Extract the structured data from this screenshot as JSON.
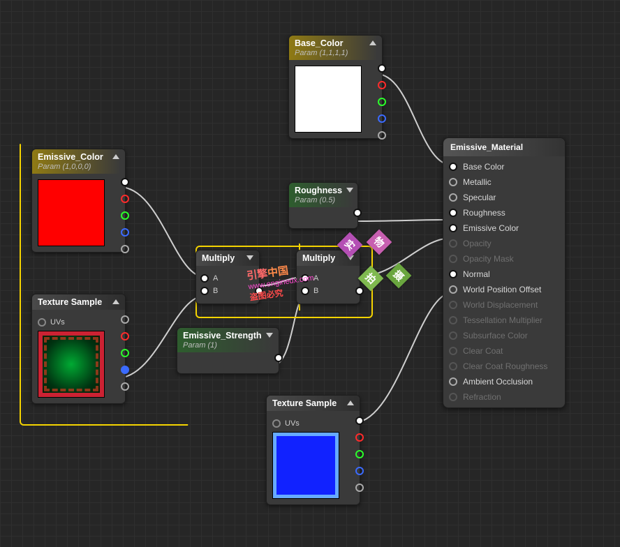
{
  "nodes": {
    "base_color": {
      "title": "Base_Color",
      "sub": "Param (1,1,1,1)"
    },
    "emissive_color": {
      "title": "Emissive_Color",
      "sub": "Param (1,0,0,0)"
    },
    "roughness": {
      "title": "Roughness",
      "sub": "Param (0.5)"
    },
    "emissive_str": {
      "title": "Emissive_Strength",
      "sub": "Param (1)"
    },
    "multiply1": {
      "title": "Multiply"
    },
    "multiply2": {
      "title": "Multiply"
    },
    "texsample1": {
      "title": "Texture Sample"
    },
    "texsample2": {
      "title": "Texture Sample"
    }
  },
  "labels": {
    "pin_a": "A",
    "pin_b": "B",
    "uvs": "UVs"
  },
  "result": {
    "title": "Emissive_Material",
    "pins": [
      {
        "label": "Base Color",
        "active": true,
        "connected": true
      },
      {
        "label": "Metallic",
        "active": true,
        "connected": false
      },
      {
        "label": "Specular",
        "active": true,
        "connected": false
      },
      {
        "label": "Roughness",
        "active": true,
        "connected": true
      },
      {
        "label": "Emissive Color",
        "active": true,
        "connected": true
      },
      {
        "label": "Opacity",
        "active": false,
        "connected": false
      },
      {
        "label": "Opacity Mask",
        "active": false,
        "connected": false
      },
      {
        "label": "Normal",
        "active": true,
        "connected": true
      },
      {
        "label": "World Position Offset",
        "active": true,
        "connected": false
      },
      {
        "label": "World Displacement",
        "active": false,
        "connected": false
      },
      {
        "label": "Tessellation Multiplier",
        "active": false,
        "connected": false
      },
      {
        "label": "Subsurface Color",
        "active": false,
        "connected": false
      },
      {
        "label": "Clear Coat",
        "active": false,
        "connected": false
      },
      {
        "label": "Clear Coat Roughness",
        "active": false,
        "connected": false
      },
      {
        "label": "Ambient Occlusion",
        "active": true,
        "connected": false
      },
      {
        "label": "Refraction",
        "active": false,
        "connected": false
      }
    ]
  },
  "watermark": {
    "line1_a": "引擎",
    "line1_b": "中国",
    "url": "www.enginedx.com",
    "line3": "盗图必究",
    "tiles": [
      "实",
      "物",
      "拍",
      "摄"
    ]
  }
}
